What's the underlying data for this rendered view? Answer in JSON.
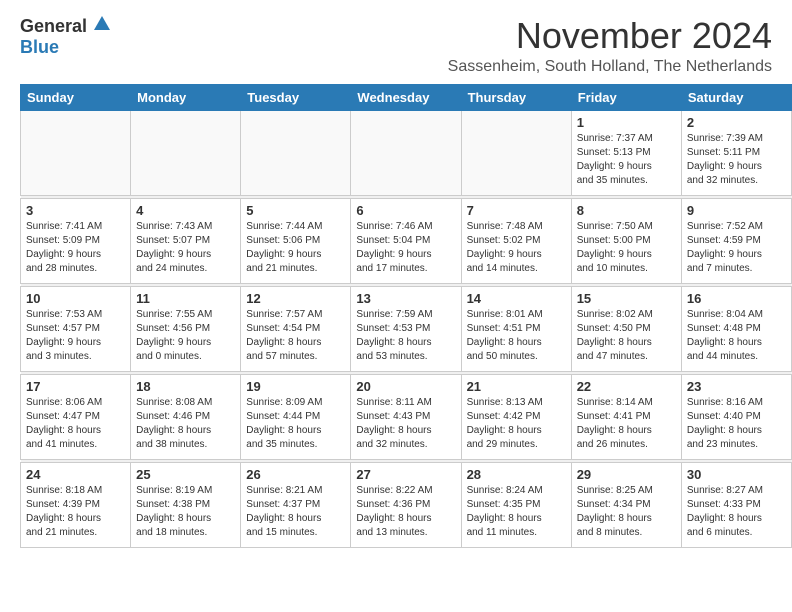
{
  "logo": {
    "general": "General",
    "blue": "Blue"
  },
  "title": "November 2024",
  "location": "Sassenheim, South Holland, The Netherlands",
  "days_of_week": [
    "Sunday",
    "Monday",
    "Tuesday",
    "Wednesday",
    "Thursday",
    "Friday",
    "Saturday"
  ],
  "weeks": [
    [
      {
        "day": "",
        "info": ""
      },
      {
        "day": "",
        "info": ""
      },
      {
        "day": "",
        "info": ""
      },
      {
        "day": "",
        "info": ""
      },
      {
        "day": "",
        "info": ""
      },
      {
        "day": "1",
        "info": "Sunrise: 7:37 AM\nSunset: 5:13 PM\nDaylight: 9 hours\nand 35 minutes."
      },
      {
        "day": "2",
        "info": "Sunrise: 7:39 AM\nSunset: 5:11 PM\nDaylight: 9 hours\nand 32 minutes."
      }
    ],
    [
      {
        "day": "3",
        "info": "Sunrise: 7:41 AM\nSunset: 5:09 PM\nDaylight: 9 hours\nand 28 minutes."
      },
      {
        "day": "4",
        "info": "Sunrise: 7:43 AM\nSunset: 5:07 PM\nDaylight: 9 hours\nand 24 minutes."
      },
      {
        "day": "5",
        "info": "Sunrise: 7:44 AM\nSunset: 5:06 PM\nDaylight: 9 hours\nand 21 minutes."
      },
      {
        "day": "6",
        "info": "Sunrise: 7:46 AM\nSunset: 5:04 PM\nDaylight: 9 hours\nand 17 minutes."
      },
      {
        "day": "7",
        "info": "Sunrise: 7:48 AM\nSunset: 5:02 PM\nDaylight: 9 hours\nand 14 minutes."
      },
      {
        "day": "8",
        "info": "Sunrise: 7:50 AM\nSunset: 5:00 PM\nDaylight: 9 hours\nand 10 minutes."
      },
      {
        "day": "9",
        "info": "Sunrise: 7:52 AM\nSunset: 4:59 PM\nDaylight: 9 hours\nand 7 minutes."
      }
    ],
    [
      {
        "day": "10",
        "info": "Sunrise: 7:53 AM\nSunset: 4:57 PM\nDaylight: 9 hours\nand 3 minutes."
      },
      {
        "day": "11",
        "info": "Sunrise: 7:55 AM\nSunset: 4:56 PM\nDaylight: 9 hours\nand 0 minutes."
      },
      {
        "day": "12",
        "info": "Sunrise: 7:57 AM\nSunset: 4:54 PM\nDaylight: 8 hours\nand 57 minutes."
      },
      {
        "day": "13",
        "info": "Sunrise: 7:59 AM\nSunset: 4:53 PM\nDaylight: 8 hours\nand 53 minutes."
      },
      {
        "day": "14",
        "info": "Sunrise: 8:01 AM\nSunset: 4:51 PM\nDaylight: 8 hours\nand 50 minutes."
      },
      {
        "day": "15",
        "info": "Sunrise: 8:02 AM\nSunset: 4:50 PM\nDaylight: 8 hours\nand 47 minutes."
      },
      {
        "day": "16",
        "info": "Sunrise: 8:04 AM\nSunset: 4:48 PM\nDaylight: 8 hours\nand 44 minutes."
      }
    ],
    [
      {
        "day": "17",
        "info": "Sunrise: 8:06 AM\nSunset: 4:47 PM\nDaylight: 8 hours\nand 41 minutes."
      },
      {
        "day": "18",
        "info": "Sunrise: 8:08 AM\nSunset: 4:46 PM\nDaylight: 8 hours\nand 38 minutes."
      },
      {
        "day": "19",
        "info": "Sunrise: 8:09 AM\nSunset: 4:44 PM\nDaylight: 8 hours\nand 35 minutes."
      },
      {
        "day": "20",
        "info": "Sunrise: 8:11 AM\nSunset: 4:43 PM\nDaylight: 8 hours\nand 32 minutes."
      },
      {
        "day": "21",
        "info": "Sunrise: 8:13 AM\nSunset: 4:42 PM\nDaylight: 8 hours\nand 29 minutes."
      },
      {
        "day": "22",
        "info": "Sunrise: 8:14 AM\nSunset: 4:41 PM\nDaylight: 8 hours\nand 26 minutes."
      },
      {
        "day": "23",
        "info": "Sunrise: 8:16 AM\nSunset: 4:40 PM\nDaylight: 8 hours\nand 23 minutes."
      }
    ],
    [
      {
        "day": "24",
        "info": "Sunrise: 8:18 AM\nSunset: 4:39 PM\nDaylight: 8 hours\nand 21 minutes."
      },
      {
        "day": "25",
        "info": "Sunrise: 8:19 AM\nSunset: 4:38 PM\nDaylight: 8 hours\nand 18 minutes."
      },
      {
        "day": "26",
        "info": "Sunrise: 8:21 AM\nSunset: 4:37 PM\nDaylight: 8 hours\nand 15 minutes."
      },
      {
        "day": "27",
        "info": "Sunrise: 8:22 AM\nSunset: 4:36 PM\nDaylight: 8 hours\nand 13 minutes."
      },
      {
        "day": "28",
        "info": "Sunrise: 8:24 AM\nSunset: 4:35 PM\nDaylight: 8 hours\nand 11 minutes."
      },
      {
        "day": "29",
        "info": "Sunrise: 8:25 AM\nSunset: 4:34 PM\nDaylight: 8 hours\nand 8 minutes."
      },
      {
        "day": "30",
        "info": "Sunrise: 8:27 AM\nSunset: 4:33 PM\nDaylight: 8 hours\nand 6 minutes."
      }
    ]
  ]
}
